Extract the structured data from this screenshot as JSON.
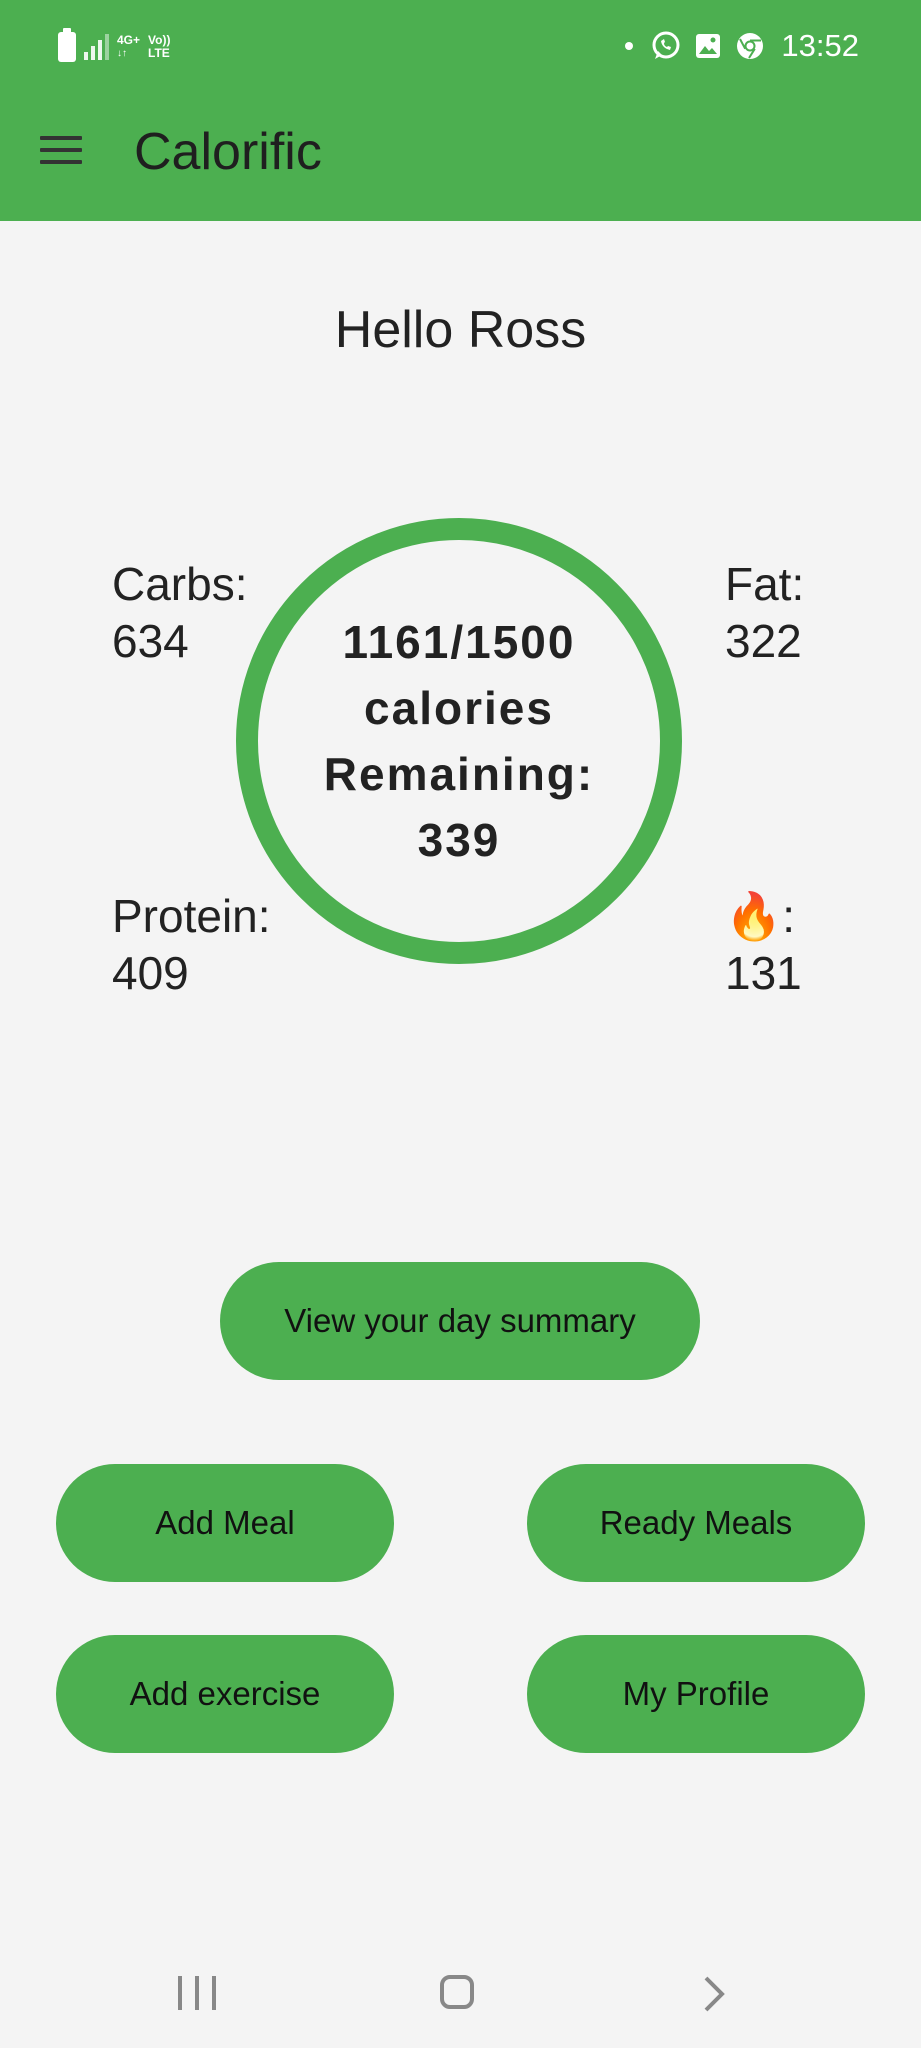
{
  "status_bar": {
    "network_label_top": "4G+",
    "network_label_bottom": "LTE",
    "volte_label": "Vo))",
    "time": "13:52",
    "icons": [
      "battery-icon",
      "signal-icon",
      "whatsapp-icon",
      "gallery-icon",
      "chrome-icon"
    ]
  },
  "app_bar": {
    "title": "Calorific",
    "menu_icon": "hamburger-menu-icon"
  },
  "greeting": "Hello Ross",
  "stats": {
    "carbs_label": "Carbs:",
    "carbs_value": "634",
    "fat_label": "Fat:",
    "fat_value": "322",
    "protein_label": "Protein:",
    "protein_value": "409",
    "burned_label": "🔥:",
    "burned_value": "131"
  },
  "ring": {
    "line1": "1161/1500",
    "line2": "calories",
    "line3": "Remaining:",
    "line4": "339"
  },
  "buttons": {
    "summary": "View your day summary",
    "add_meal": "Add Meal",
    "ready_meals": "Ready Meals",
    "add_exercise": "Add exercise",
    "my_profile": "My Profile"
  },
  "colors": {
    "accent": "#4caf50",
    "background": "#f4f4f4",
    "text": "#222222"
  }
}
